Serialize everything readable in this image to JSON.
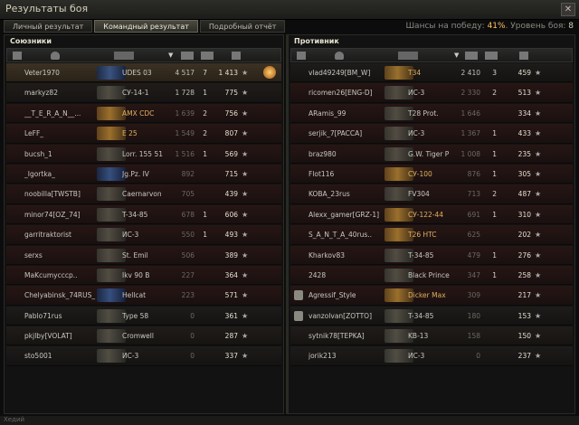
{
  "window": {
    "title": "Результаты боя",
    "close": "✕"
  },
  "tabs": [
    "Личный результат",
    "Командный результат",
    "Подробный отчёт"
  ],
  "win_info": {
    "prefix": "Шансы на победу: ",
    "pct": "41%",
    "mid": ". Уровень боя: ",
    "level": "8"
  },
  "allies": {
    "title": "Союзники",
    "rows": [
      {
        "name": "Veter1970",
        "tank": "UDES 03",
        "dmg": "4 517",
        "kills": "7",
        "exp": "1 413",
        "style": "self",
        "tankcls": "blue",
        "medal": true
      },
      {
        "name": "markyz82",
        "tank": "СУ-14-1",
        "dmg": "1 728",
        "kills": "1",
        "exp": "775"
      },
      {
        "name": "__T_E_R_A_N__...",
        "tank": "AMX CDC",
        "dmg": "1 639",
        "kills": "2",
        "exp": "756",
        "style": "red",
        "dim": true,
        "tankcls": "prem"
      },
      {
        "name": "LeFF_",
        "tank": "E 25",
        "dmg": "1 549",
        "kills": "2",
        "exp": "807",
        "style": "red",
        "dim": true,
        "tankcls": "prem"
      },
      {
        "name": "bucsh_1",
        "tank": "Lorr. 155 51",
        "dmg": "1 516",
        "kills": "1",
        "exp": "569",
        "style": "red",
        "dim": true
      },
      {
        "name": "_Igortka_",
        "tank": "Jg.Pz. IV",
        "dmg": "892",
        "kills": "",
        "exp": "715",
        "style": "red",
        "dim": true,
        "tankcls": "blue"
      },
      {
        "name": "noobilla[TWSTB]",
        "tank": "Caernarvon",
        "dmg": "705",
        "kills": "",
        "exp": "439",
        "style": "red",
        "dim": true
      },
      {
        "name": "minor74[OZ_74]",
        "tank": "T-34-85",
        "dmg": "678",
        "kills": "1",
        "exp": "606",
        "style": "red",
        "dim": true
      },
      {
        "name": "garritraktorist",
        "tank": "ИС-3",
        "dmg": "550",
        "kills": "1",
        "exp": "493",
        "style": "red",
        "dim": true
      },
      {
        "name": "serxs",
        "tank": "St. Emil",
        "dmg": "506",
        "kills": "",
        "exp": "389",
        "style": "red",
        "dim": true
      },
      {
        "name": "MaKcumycccp..",
        "tank": "Ikv 90 B",
        "dmg": "227",
        "kills": "",
        "exp": "364",
        "style": "red",
        "dim": true
      },
      {
        "name": "Chelyabinsk_74RUS_",
        "tank": "Hellcat",
        "dmg": "223",
        "kills": "",
        "exp": "571",
        "style": "red",
        "dim": true,
        "tankcls": "blue"
      },
      {
        "name": "Pablo71rus",
        "tank": "Type 58",
        "dmg": "0",
        "kills": "",
        "exp": "361",
        "dim": true
      },
      {
        "name": "pkjlby[VOLAT]",
        "tank": "Cromwell",
        "dmg": "0",
        "kills": "",
        "exp": "287",
        "dim": true
      },
      {
        "name": "sto5001",
        "tank": "ИС-3",
        "dmg": "0",
        "kills": "",
        "exp": "337",
        "dim": true
      }
    ]
  },
  "enemies": {
    "title": "Противник",
    "rows": [
      {
        "name": "vlad49249[BM_W]",
        "tank": "T34",
        "dmg": "2 410",
        "kills": "3",
        "exp": "459",
        "tankcls": "prem"
      },
      {
        "name": "ricomen26[ENG-D]",
        "tank": "ИС-3",
        "dmg": "2 330",
        "kills": "2",
        "exp": "513",
        "style": "red",
        "dim": true
      },
      {
        "name": "ARamis_99",
        "tank": "T28 Prot.",
        "dmg": "1 646",
        "kills": "",
        "exp": "334",
        "style": "red",
        "dim": true
      },
      {
        "name": "serjik_7[PACCA]",
        "tank": "ИС-3",
        "dmg": "1 367",
        "kills": "1",
        "exp": "433",
        "style": "red",
        "dim": true
      },
      {
        "name": "braz980",
        "tank": "G.W. Tiger P",
        "dmg": "1 008",
        "kills": "1",
        "exp": "235",
        "style": "red",
        "dim": true
      },
      {
        "name": "Flot116",
        "tank": "СУ-100",
        "dmg": "876",
        "kills": "1",
        "exp": "305",
        "style": "red",
        "dim": true,
        "tankcls": "prem"
      },
      {
        "name": "KOBA_23rus",
        "tank": "FV304",
        "dmg": "713",
        "kills": "2",
        "exp": "487",
        "style": "red",
        "dim": true
      },
      {
        "name": "Alexx_gamer[GRZ-1]",
        "tank": "СУ-122-44",
        "dmg": "691",
        "kills": "1",
        "exp": "310",
        "style": "red",
        "dim": true,
        "tankcls": "prem"
      },
      {
        "name": "S_A_N_T_A_40rus..",
        "tank": "T26 HTC",
        "dmg": "625",
        "kills": "",
        "exp": "202",
        "style": "red",
        "dim": true,
        "tankcls": "prem"
      },
      {
        "name": "Kharkov83",
        "tank": "T-34-85",
        "dmg": "479",
        "kills": "1",
        "exp": "276",
        "style": "red",
        "dim": true
      },
      {
        "name": "2428",
        "tank": "Black Prince",
        "dmg": "347",
        "kills": "1",
        "exp": "258",
        "style": "red",
        "dim": true
      },
      {
        "name": "Agressif_Style",
        "tank": "Dicker Max",
        "dmg": "309",
        "kills": "",
        "exp": "217",
        "style": "red",
        "dim": true,
        "badge": true,
        "tankcls": "prem"
      },
      {
        "name": "vanzolvan[ZOTTO]",
        "tank": "T-34-85",
        "dmg": "180",
        "kills": "",
        "exp": "153",
        "dim": true,
        "badge": true
      },
      {
        "name": "sytnik78[TEPKA]",
        "tank": "KB-13",
        "dmg": "158",
        "kills": "",
        "exp": "150",
        "dim": true
      },
      {
        "name": "jorik213",
        "tank": "ИС-3",
        "dmg": "0",
        "kills": "",
        "exp": "237",
        "dim": true
      }
    ]
  },
  "footer": {
    "text": "Хедий"
  }
}
